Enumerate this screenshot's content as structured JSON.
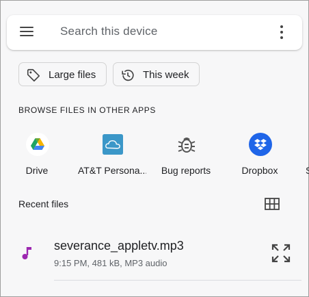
{
  "search": {
    "placeholder": "Search this device",
    "menu_icon": "menu-icon",
    "more_icon": "more-vert-icon"
  },
  "chips": [
    {
      "label": "Large files",
      "icon": "tag-icon"
    },
    {
      "label": "This week",
      "icon": "history-icon"
    }
  ],
  "browse": {
    "header": "BROWSE FILES IN OTHER APPS",
    "apps": [
      {
        "label": "Drive",
        "icon": "google-drive-icon"
      },
      {
        "label": "AT&T Persona...",
        "icon": "att-cloud-icon",
        "color": "#3b97c8"
      },
      {
        "label": "Bug reports",
        "icon": "bug-icon"
      },
      {
        "label": "Dropbox",
        "icon": "dropbox-icon",
        "color": "#1f65e8"
      }
    ],
    "partial_label": "S"
  },
  "recent": {
    "label": "Recent files",
    "view_icon": "grid-view-icon",
    "files": [
      {
        "name": "severance_appletv.mp3",
        "meta": "9:15 PM, 481 kB, MP3 audio",
        "icon": "music-note-icon",
        "icon_color": "#9c27b0"
      }
    ]
  }
}
